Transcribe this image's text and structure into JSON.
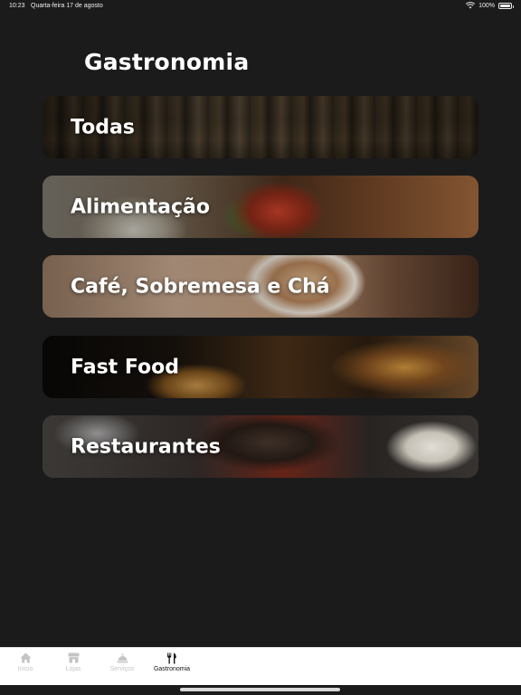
{
  "status_bar": {
    "time": "10:23",
    "date": "Quarta-feira 17 de agosto",
    "battery": "100%",
    "battery_level": 1.0
  },
  "page": {
    "title": "Gastronomia"
  },
  "categories": [
    {
      "label": "Todas",
      "image": "shopping-mall-photo"
    },
    {
      "label": "Alimentação",
      "image": "food-dish-photo"
    },
    {
      "label": "Café, Sobremesa e Chá",
      "image": "coffee-cup-photo"
    },
    {
      "label": "Fast Food",
      "image": "burger-fries-photo"
    },
    {
      "label": "Restaurantes",
      "image": "restaurant-table-photo"
    }
  ],
  "tab_bar": {
    "tabs": [
      {
        "label": "Início",
        "icon": "home-icon",
        "active": false
      },
      {
        "label": "Lojas",
        "icon": "store-icon",
        "active": false
      },
      {
        "label": "Serviços",
        "icon": "service-bell-icon",
        "active": false
      },
      {
        "label": "Gastronomia",
        "icon": "fork-knife-icon",
        "active": true
      }
    ]
  },
  "colors": {
    "background": "#1b1b1b",
    "tab_bar": "#ffffff",
    "tab_inactive": "#c4c4c4",
    "tab_active": "#111111",
    "text": "#ffffff"
  }
}
